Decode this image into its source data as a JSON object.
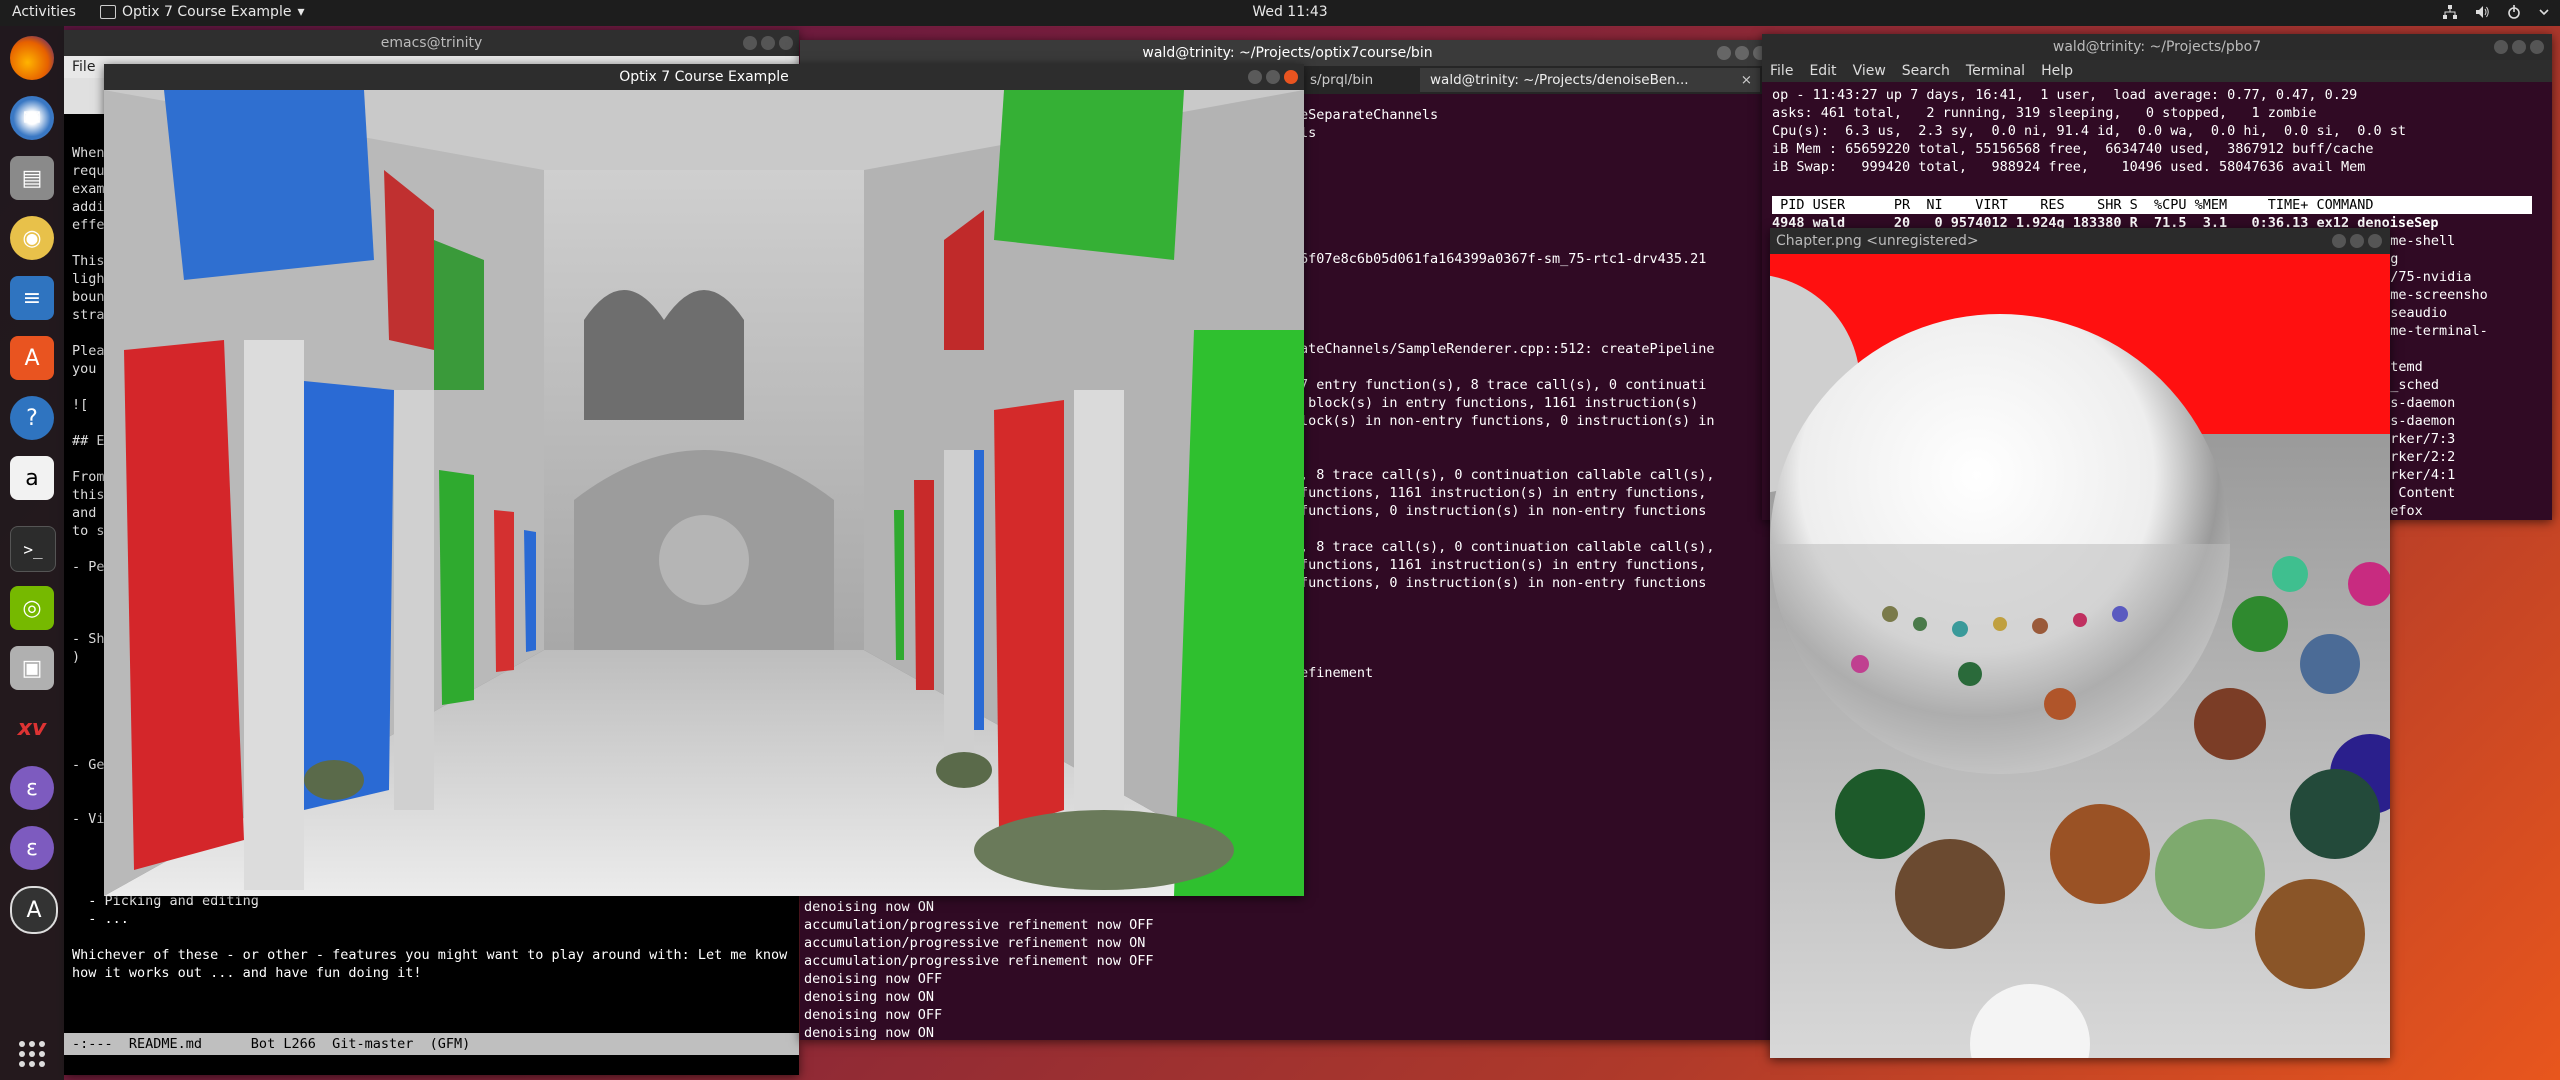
{
  "topbar": {
    "activities": "Activities",
    "app_name": "Optix 7 Course Example",
    "app_arrow": "▾",
    "clock": "Wed 11:43",
    "tray_icons": [
      "network-icon",
      "volume-icon",
      "power-icon",
      "chevron-down-icon"
    ]
  },
  "dock": {
    "items": [
      "firefox",
      "thunderbird",
      "files",
      "rhythmbox",
      "libreoffice-writer",
      "ubuntu-software",
      "help",
      "amazon",
      "terminal",
      "nvidia-settings",
      "screenshot",
      "xv",
      "emacs",
      "emacs-2",
      "software-updater",
      "show-applications"
    ]
  },
  "emacs": {
    "title": "emacs@trinity",
    "menu": [
      "File"
    ],
    "left_fragments": [
      "When",
      "requ",
      "exam",
      "addi",
      "effe",
      "",
      "This",
      "ligh",
      "boun",
      "stra",
      "",
      "Plea",
      "you ",
      "",
      "![",
      "",
      "## E",
      "",
      "From",
      "this",
      "and ",
      "to s",
      "",
      "- Pe",
      "",
      "",
      "",
      "- Sh",
      ")",
      "",
      "",
      "",
      "",
      "",
      "- Ge",
      "",
      "",
      "- Vi"
    ],
    "visible_lines": [
      "  - Picking and editing",
      "  - ...",
      "",
      "Whichever of these - or other - features you might want to play around with: Let me know",
      "how it works out ... and have fun doing it!"
    ],
    "modeline": "-:---  README.md      Bot L266  Git-master  (GFM)"
  },
  "terminal_main": {
    "title": "wald@trinity: ~/Projects/optix7course/bin",
    "tabs": [
      "s/prql/bin",
      "wald@trinity: ~/Projects/denoiseBen..."
    ],
    "upper_lines": [
      "eSeparateChannels",
      "ls",
      "",
      "",
      "",
      "",
      "",
      "",
      "6f07e8c6b05d061fa164399a0367f-sm_75-rtc1-drv435.21",
      "",
      "",
      "",
      "",
      "ateChannels/SampleRenderer.cpp::512: createPipeline",
      "",
      "7 entry function(s), 8 trace call(s), 0 continuati",
      " block(s) in entry functions, 1161 instruction(s)",
      "lock(s) in non-entry functions, 0 instruction(s) in",
      "",
      "",
      ", 8 trace call(s), 0 continuation callable call(s),",
      "functions, 1161 instruction(s) in entry functions,",
      "functions, 0 instruction(s) in non-entry functions",
      "",
      ", 8 trace call(s), 0 continuation callable call(s),",
      "functions, 1161 instruction(s) in entry functions,",
      "functions, 0 instruction(s) in non-entry functions",
      "",
      "",
      "",
      "",
      "efinement"
    ],
    "lower_lines": [
      "denoising now ON",
      "accumulation/progressive refinement now OFF",
      "accumulation/progressive refinement now ON",
      "accumulation/progressive refinement now OFF",
      "denoising now OFF",
      "denoising now ON",
      "denoising now OFF",
      "denoising now ON"
    ]
  },
  "optix_window": {
    "title": "Optix 7 Course Example"
  },
  "top_terminal": {
    "title": "wald@trinity: ~/Projects/pbo7",
    "menu": [
      "File",
      "Edit",
      "View",
      "Search",
      "Terminal",
      "Help"
    ],
    "summary": [
      "op - 11:43:27 up 7 days, 16:41,  1 user,  load average: 0.77, 0.47, 0.29",
      "asks: 461 total,   2 running, 319 sleeping,   0 stopped,   1 zombie",
      "Cpu(s):  6.3 us,  2.3 sy,  0.0 ni, 91.4 id,  0.0 wa,  0.0 hi,  0.0 si,  0.0 st",
      "iB Mem : 65659220 total, 55156568 free,  6634740 used,  3867912 buff/cache",
      "iB Swap:   999420 total,   988924 free,    10496 used. 58047636 avail Mem"
    ],
    "header": " PID USER      PR  NI    VIRT    RES    SHR S  %CPU %MEM     TIME+ COMMAND",
    "first_row": "4948 wald      20   0 9574012 1.924g 183380 R  71.5  3.1   0:36.13 ex12_denoiseSep",
    "commands": [
      "nome-shell",
      "org",
      "rq/75-nvidia",
      "nome-screensho",
      "ulseaudio",
      "nome-terminal-",
      "op",
      "ystemd",
      "cu_sched",
      "bus-daemon",
      "bus-daemon",
      "worker/7:3",
      "worker/2:2",
      "worker/4:1",
      "eb Content",
      "irefox"
    ]
  },
  "image_viewer": {
    "title": "Chapter.png <unregistered>"
  },
  "colors": {
    "terminal_bg": "#300a24",
    "topbar_bg": "#1d1d1d",
    "close_button": "#e95420"
  }
}
